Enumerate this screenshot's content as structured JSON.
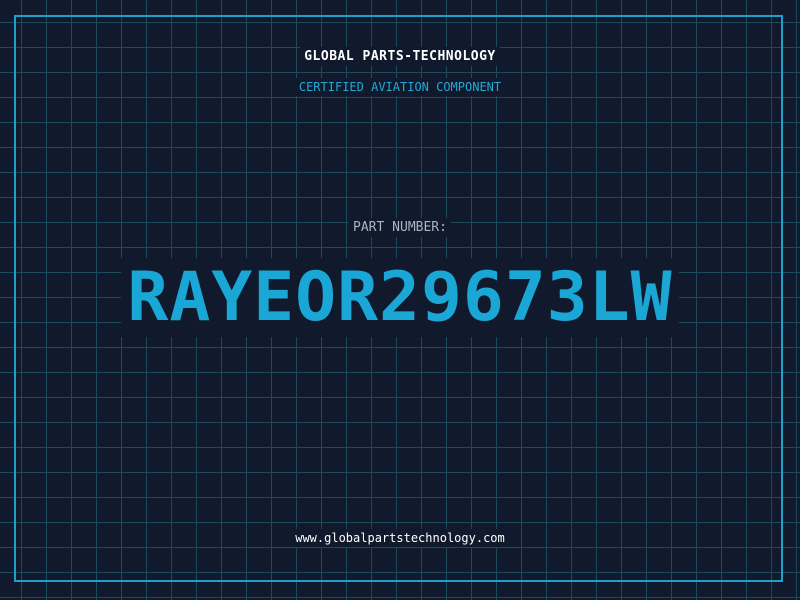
{
  "company": "GLOBAL PARTS-TECHNOLOGY",
  "tagline": "CERTIFIED AVIATION COMPONENT",
  "part_label": "PART NUMBER:",
  "part_number": "RAYEOR29673LW",
  "website": "www.globalpartstechnology.com",
  "colors": {
    "background": "#111a2c",
    "grid": "#1e4a5e",
    "accent": "#1ea0c8",
    "text": "#ffffff"
  }
}
